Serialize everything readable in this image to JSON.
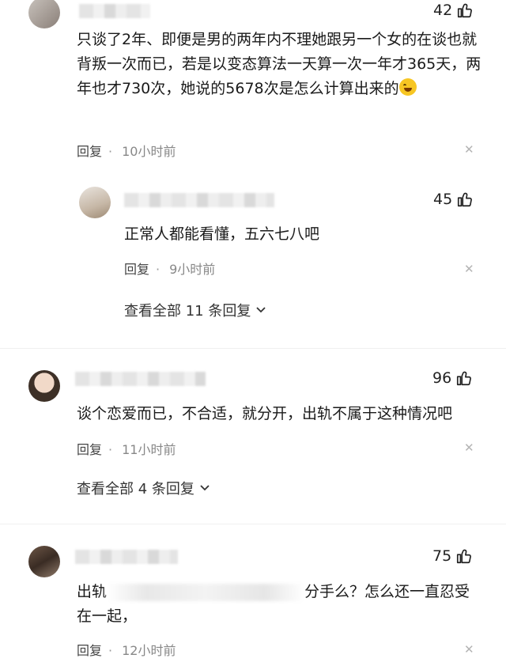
{
  "comments": [
    {
      "likes": "42",
      "text": "只谈了2年、即便是男的两年内不理她跟另一个女的在谈也就背叛一次而已，若是以变态算法一天算一次一年才365天，两年也才730次，她说的5678次是怎么计算出来的",
      "reply_label": "回复",
      "time": "10小时前",
      "sub_reply": {
        "likes": "45",
        "text": "正常人都能看懂，五六七八吧",
        "reply_label": "回复",
        "time": "9小时前"
      },
      "view_all": "查看全部 11 条回复"
    },
    {
      "likes": "96",
      "text": "谈个恋爱而已，不合适，就分开，出轨不属于这种情况吧",
      "reply_label": "回复",
      "time": "11小时前",
      "view_all": "查看全部 4 条回复"
    },
    {
      "likes": "75",
      "text_start": "出轨",
      "text_end": "分手么？怎么还一直忍受",
      "text_line2": "在一起，",
      "reply_label": "回复",
      "time": "12小时前"
    }
  ],
  "icons": {
    "like": "thumbs-up-icon",
    "close": "close-icon",
    "expand": "chevron-down-icon",
    "emoji": "laughing-tears-emoji-icon"
  }
}
